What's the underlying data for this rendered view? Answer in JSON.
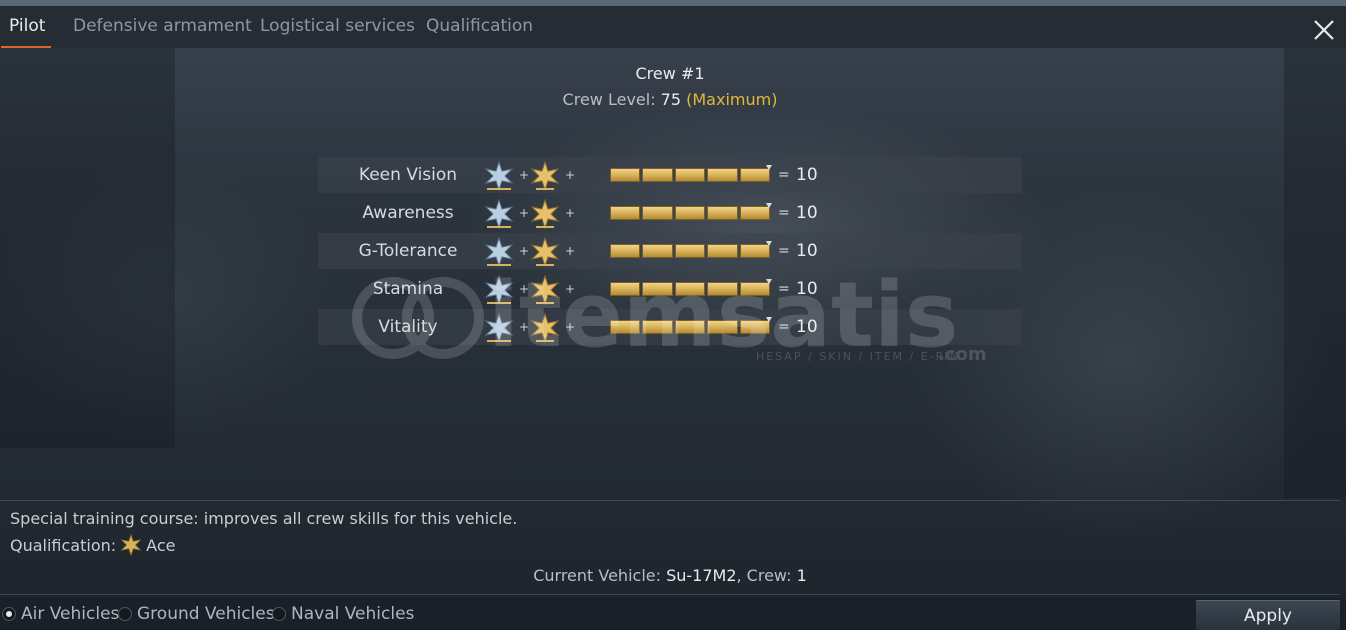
{
  "tabs": [
    {
      "label": "Pilot",
      "active": true
    },
    {
      "label": "Defensive armament",
      "active": false
    },
    {
      "label": "Logistical services",
      "active": false
    },
    {
      "label": "Qualification",
      "active": false
    }
  ],
  "crew": {
    "title": "Crew #1",
    "level_label": "Crew Level: ",
    "level_value": "75",
    "level_note": "(Maximum)"
  },
  "skills": [
    {
      "name": "Keen Vision",
      "value": "10",
      "filled": 5
    },
    {
      "name": "Awareness",
      "value": "10",
      "filled": 5
    },
    {
      "name": "G-Tolerance",
      "value": "10",
      "filled": 5
    },
    {
      "name": "Stamina",
      "value": "10",
      "filled": 5
    },
    {
      "name": "Vitality",
      "value": "10",
      "filled": 5
    }
  ],
  "symbols": {
    "plus": "+",
    "equals": "="
  },
  "watermark": {
    "text": "itemsatis",
    "sub": "HESAP / SKIN / ITEM / E-PIN",
    "suffix": ".com"
  },
  "info": {
    "description": "Special training course: improves all crew skills for this vehicle.",
    "qualification_label": "Qualification: ",
    "qualification_value": "Ace",
    "current_vehicle_label": "Current Vehicle: ",
    "current_vehicle": "Su-17M2",
    "crew_label": ", Crew: ",
    "crew_value": "1"
  },
  "vehicle_types": [
    {
      "label": "Air Vehicles",
      "selected": true
    },
    {
      "label": "Ground Vehicles",
      "selected": false
    },
    {
      "label": "Naval Vehicles",
      "selected": false
    }
  ],
  "apply_label": "Apply",
  "icons": {
    "close": "close-icon",
    "expert": "silver-star-icon",
    "ace": "gold-star-icon"
  },
  "colors": {
    "accent_tab": "#d9662f",
    "maximum_text": "#e0b93a",
    "skill_bar": "#d8b25a"
  }
}
